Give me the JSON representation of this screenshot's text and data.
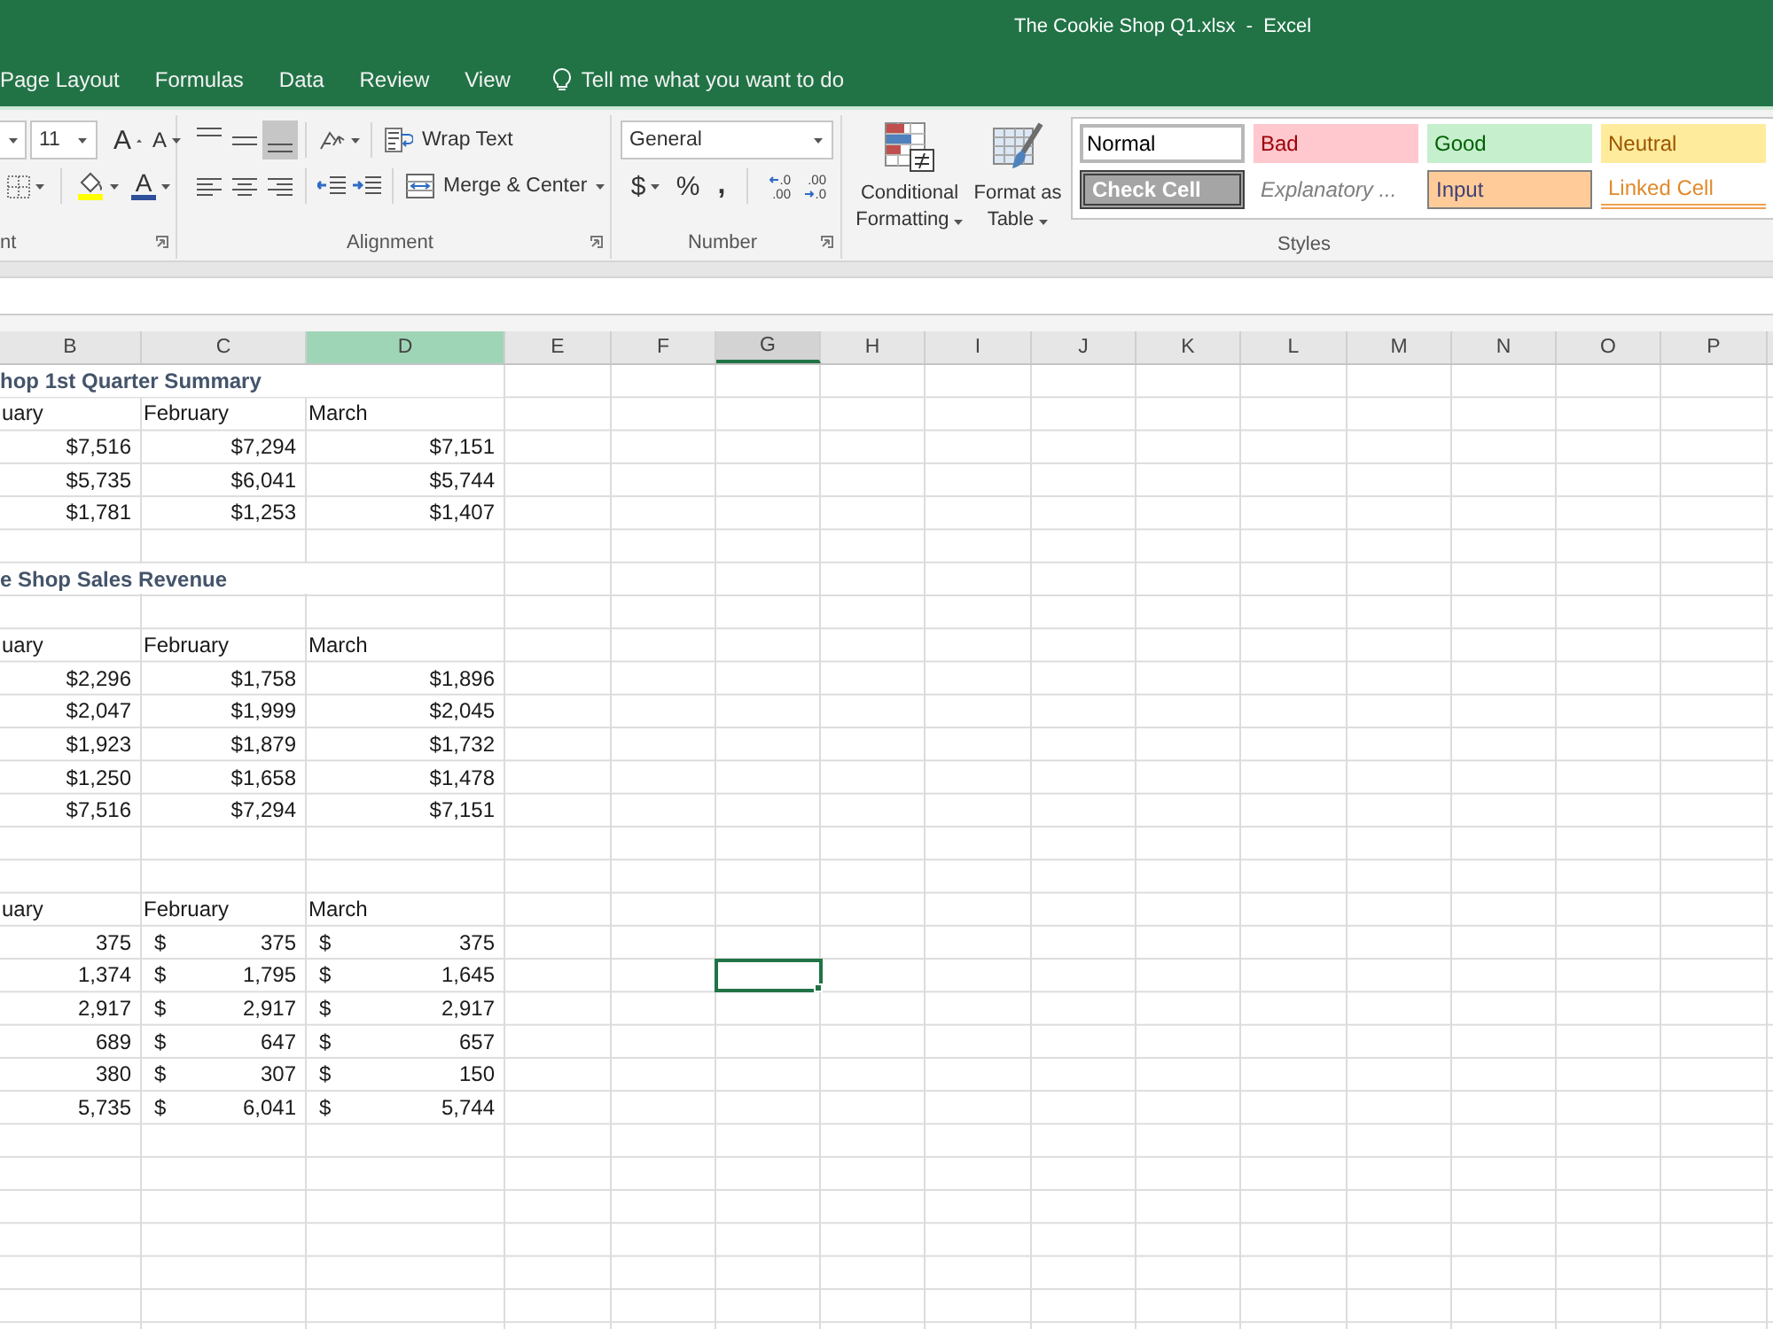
{
  "window": {
    "title": "The Cookie Shop Q1.xlsx  -  Excel"
  },
  "tabs": [
    {
      "label": "Page Layout"
    },
    {
      "label": "Formulas"
    },
    {
      "label": "Data"
    },
    {
      "label": "Review"
    },
    {
      "label": "View"
    }
  ],
  "tell_me": {
    "placeholder": "Tell me what you want to do"
  },
  "ribbon": {
    "font": {
      "label": "nt",
      "size": "11",
      "size_buttons": [
        {
          "kind": "grow",
          "glyph": "A"
        },
        {
          "kind": "shrink",
          "glyph": "A"
        }
      ],
      "font_color_glyph": "A"
    },
    "alignment": {
      "label": "Alignment",
      "vertical": [
        {
          "kind": "top",
          "selected": false
        },
        {
          "kind": "middle",
          "selected": false
        },
        {
          "kind": "bottom",
          "selected": true
        }
      ],
      "horizontal": [
        {
          "kind": "left",
          "selected": false
        },
        {
          "kind": "center",
          "selected": false
        },
        {
          "kind": "right",
          "selected": false
        }
      ],
      "wrap_text": "Wrap Text",
      "merge": "Merge & Center"
    },
    "number": {
      "label": "Number",
      "format": "General",
      "symbols": [
        {
          "kind": "currency",
          "glyph": "$"
        },
        {
          "kind": "percent",
          "glyph": "%"
        },
        {
          "kind": "comma",
          "glyph": ","
        }
      ],
      "decimals": [
        {
          "kind": "increase",
          "top": ".0",
          "bottom": ".00"
        },
        {
          "kind": "decrease",
          "top": ".00",
          "bottom": ".0"
        }
      ]
    },
    "styles": {
      "label": "Styles",
      "conditional": "Conditional Formatting",
      "table": "Format as Table",
      "gallery": [
        {
          "kind": "normal",
          "label": "Normal",
          "selected": true
        },
        {
          "kind": "bad",
          "label": "Bad",
          "selected": false
        },
        {
          "kind": "good",
          "label": "Good",
          "selected": false
        },
        {
          "kind": "neutral",
          "label": "Neutral",
          "selected": false
        },
        {
          "kind": "check",
          "label": "Check Cell",
          "selected": false
        },
        {
          "kind": "explanatory",
          "label": "Explanatory ...",
          "selected": false
        },
        {
          "kind": "input",
          "label": "Input",
          "selected": false
        },
        {
          "kind": "linked",
          "label": "Linked Cell",
          "selected": false
        }
      ]
    }
  },
  "sheet": {
    "columns": [
      {
        "label": "B",
        "selected": false,
        "highlighted": false
      },
      {
        "label": "C",
        "selected": false,
        "highlighted": false
      },
      {
        "label": "D",
        "selected": false,
        "highlighted": true
      },
      {
        "label": "E",
        "selected": false,
        "highlighted": false
      },
      {
        "label": "F",
        "selected": false,
        "highlighted": false
      },
      {
        "label": "G",
        "selected": true,
        "highlighted": false
      },
      {
        "label": "H",
        "selected": false,
        "highlighted": false
      },
      {
        "label": "I",
        "selected": false,
        "highlighted": false
      },
      {
        "label": "J",
        "selected": false,
        "highlighted": false
      },
      {
        "label": "K",
        "selected": false,
        "highlighted": false
      },
      {
        "label": "L",
        "selected": false,
        "highlighted": false
      },
      {
        "label": "M",
        "selected": false,
        "highlighted": false
      },
      {
        "label": "N",
        "selected": false,
        "highlighted": false
      },
      {
        "label": "O",
        "selected": false,
        "highlighted": false
      },
      {
        "label": "P",
        "selected": false,
        "highlighted": false
      }
    ],
    "rows": [
      {
        "active": false,
        "cells": [
          {
            "kind": "title",
            "text": "hop 1st Quarter Summary"
          }
        ]
      },
      {
        "active": false,
        "cells": [
          {
            "kind": "text",
            "text": "uary"
          },
          {
            "kind": "text",
            "text": "February"
          },
          {
            "kind": "text",
            "text": "March"
          }
        ]
      },
      {
        "active": false,
        "cells": [
          {
            "kind": "number",
            "text": "$7,516"
          },
          {
            "kind": "number",
            "text": "$7,294"
          },
          {
            "kind": "number",
            "text": "$7,151"
          }
        ]
      },
      {
        "active": false,
        "cells": [
          {
            "kind": "number",
            "text": "$5,735"
          },
          {
            "kind": "number",
            "text": "$6,041"
          },
          {
            "kind": "number",
            "text": "$5,744"
          }
        ]
      },
      {
        "active": false,
        "cells": [
          {
            "kind": "number",
            "text": "$1,781"
          },
          {
            "kind": "number",
            "text": "$1,253"
          },
          {
            "kind": "number",
            "text": "$1,407"
          }
        ]
      },
      {
        "active": false,
        "cells": []
      },
      {
        "active": false,
        "cells": [
          {
            "kind": "title",
            "text": "e Shop Sales Revenue"
          }
        ]
      },
      {
        "active": false,
        "cells": []
      },
      {
        "active": false,
        "cells": [
          {
            "kind": "text",
            "text": "uary"
          },
          {
            "kind": "text",
            "text": "February"
          },
          {
            "kind": "text",
            "text": "March"
          }
        ]
      },
      {
        "active": false,
        "cells": [
          {
            "kind": "number",
            "text": "$2,296"
          },
          {
            "kind": "number",
            "text": "$1,758"
          },
          {
            "kind": "number",
            "text": "$1,896"
          }
        ]
      },
      {
        "active": false,
        "cells": [
          {
            "kind": "number",
            "text": "$2,047"
          },
          {
            "kind": "number",
            "text": "$1,999"
          },
          {
            "kind": "number",
            "text": "$2,045"
          }
        ]
      },
      {
        "active": false,
        "cells": [
          {
            "kind": "number",
            "text": "$1,923"
          },
          {
            "kind": "number",
            "text": "$1,879"
          },
          {
            "kind": "number",
            "text": "$1,732"
          }
        ]
      },
      {
        "active": false,
        "cells": [
          {
            "kind": "number",
            "text": "$1,250"
          },
          {
            "kind": "number",
            "text": "$1,658"
          },
          {
            "kind": "number",
            "text": "$1,478"
          }
        ]
      },
      {
        "active": false,
        "cells": [
          {
            "kind": "number",
            "text": "$7,516"
          },
          {
            "kind": "number",
            "text": "$7,294"
          },
          {
            "kind": "number",
            "text": "$7,151"
          }
        ]
      },
      {
        "active": false,
        "cells": []
      },
      {
        "active": false,
        "cells": []
      },
      {
        "active": false,
        "cells": [
          {
            "kind": "text",
            "text": "uary"
          },
          {
            "kind": "text",
            "text": "February"
          },
          {
            "kind": "text",
            "text": "March"
          }
        ]
      },
      {
        "active": false,
        "cells": [
          {
            "kind": "number",
            "text": "375"
          },
          {
            "kind": "accounting",
            "symbol": "$",
            "text": "375"
          },
          {
            "kind": "accounting",
            "symbol": "$",
            "text": "375"
          }
        ]
      },
      {
        "active": true,
        "cells": [
          {
            "kind": "number",
            "text": "1,374"
          },
          {
            "kind": "accounting",
            "symbol": "$",
            "text": "1,795"
          },
          {
            "kind": "accounting",
            "symbol": "$",
            "text": "1,645"
          }
        ]
      },
      {
        "active": false,
        "cells": [
          {
            "kind": "number",
            "text": "2,917"
          },
          {
            "kind": "accounting",
            "symbol": "$",
            "text": "2,917"
          },
          {
            "kind": "accounting",
            "symbol": "$",
            "text": "2,917"
          }
        ]
      },
      {
        "active": false,
        "cells": [
          {
            "kind": "number",
            "text": "689"
          },
          {
            "kind": "accounting",
            "symbol": "$",
            "text": "647"
          },
          {
            "kind": "accounting",
            "symbol": "$",
            "text": "657"
          }
        ]
      },
      {
        "active": false,
        "cells": [
          {
            "kind": "number",
            "text": "380"
          },
          {
            "kind": "accounting",
            "symbol": "$",
            "text": "307"
          },
          {
            "kind": "accounting",
            "symbol": "$",
            "text": "150"
          }
        ]
      },
      {
        "active": false,
        "cells": [
          {
            "kind": "number",
            "text": "5,735"
          },
          {
            "kind": "accounting",
            "symbol": "$",
            "text": "6,041"
          },
          {
            "kind": "accounting",
            "symbol": "$",
            "text": "5,744"
          }
        ]
      },
      {
        "active": false,
        "cells": []
      },
      {
        "active": false,
        "cells": []
      },
      {
        "active": false,
        "cells": []
      },
      {
        "active": false,
        "cells": []
      },
      {
        "active": false,
        "cells": []
      },
      {
        "active": false,
        "cells": []
      }
    ]
  }
}
